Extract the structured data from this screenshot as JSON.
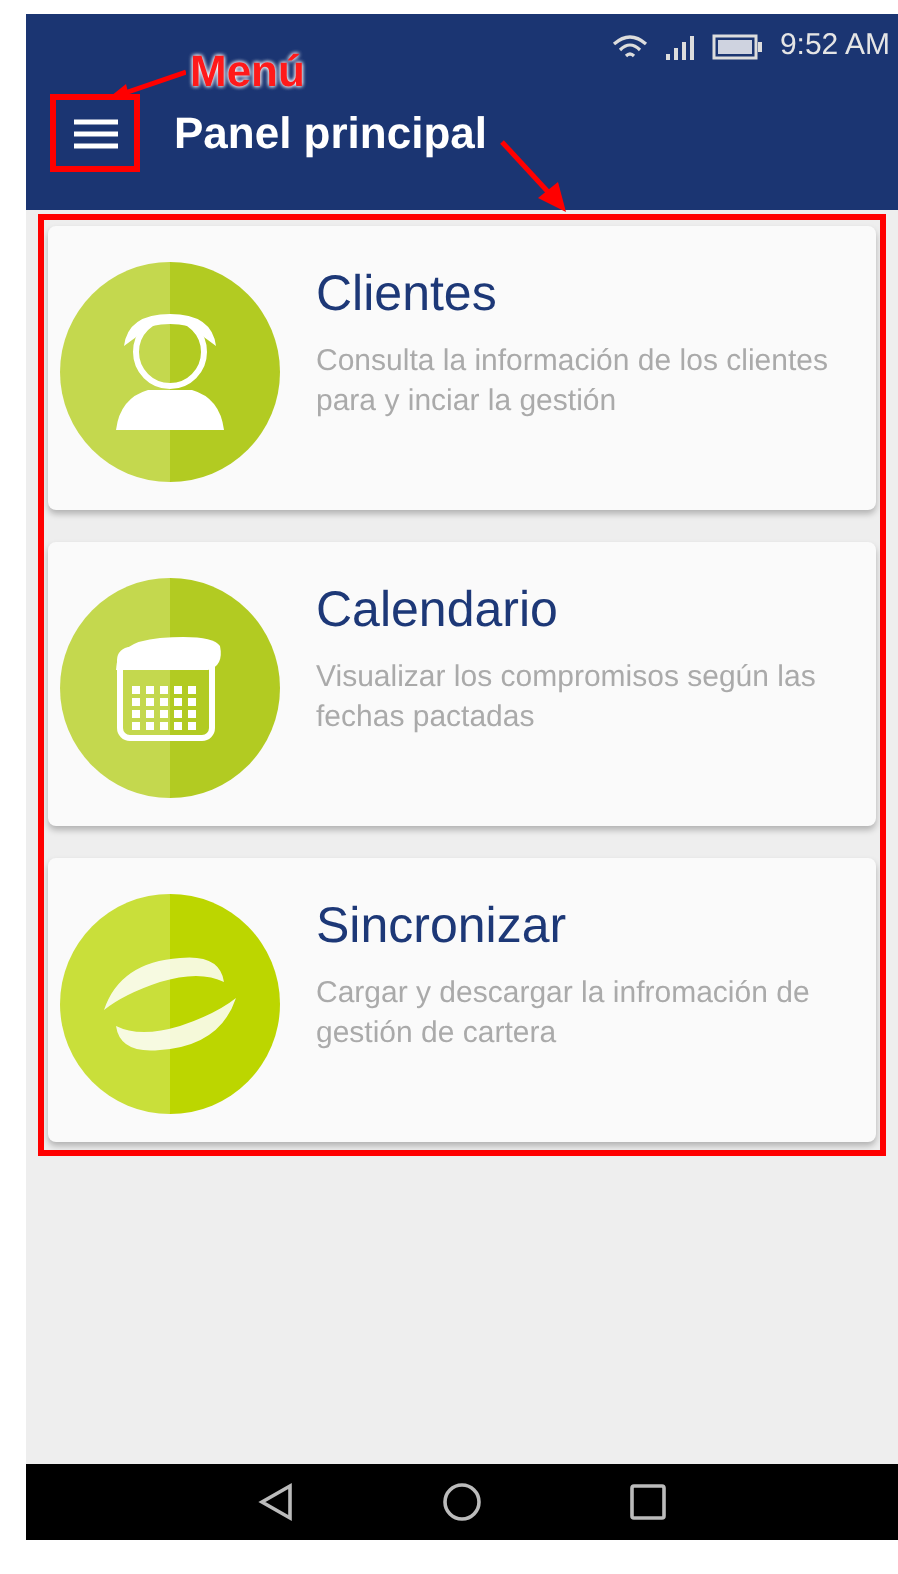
{
  "status_bar": {
    "time": "9:52 AM"
  },
  "annotation": {
    "label": "Menú"
  },
  "toolbar": {
    "title": "Panel principal"
  },
  "cards": [
    {
      "kind": "clients",
      "title": "Clientes",
      "description": "Consulta la información de los clientes para y inciar la gestión"
    },
    {
      "kind": "calendar",
      "title": "Calendario",
      "description": "Visualizar los compromisos según las fechas pactadas"
    },
    {
      "kind": "sync",
      "title": "Sincronizar",
      "description": "Cargar y descargar la infromación de gestión de cartera"
    }
  ]
}
